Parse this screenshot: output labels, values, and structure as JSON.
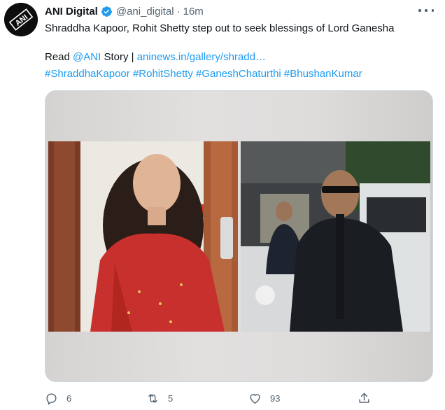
{
  "account": {
    "display_name": "ANI Digital",
    "handle": "@ani_digital",
    "separator": "·",
    "time": "16m",
    "avatar_text": "ANI"
  },
  "tweet": {
    "text": "Shraddha Kapoor, Rohit Shetty step out to seek blessings of Lord Ganesha",
    "read_prefix": "Read",
    "mention": "@ANI",
    "read_suffix": "Story |",
    "link": "aninews.in/gallery/shradd…",
    "hashtags": [
      "#ShraddhaKapoor",
      "#RohitShetty",
      "#GaneshChaturthi",
      "#BhushanKumar"
    ]
  },
  "media": {
    "left_photo": "photo",
    "right_photo": "photo"
  },
  "actions": {
    "reply_count": "6",
    "retweet_count": "5",
    "like_count": "93"
  },
  "colors": {
    "link": "#1d9bf0",
    "secondary_text": "#536471",
    "primary_text": "#0f1419",
    "verified": "#1d9bf0",
    "red_dress": "#c7302d"
  },
  "icons": [
    "verified-badge-icon",
    "more-options-icon",
    "reply-icon",
    "retweet-icon",
    "like-icon",
    "share-icon"
  ]
}
